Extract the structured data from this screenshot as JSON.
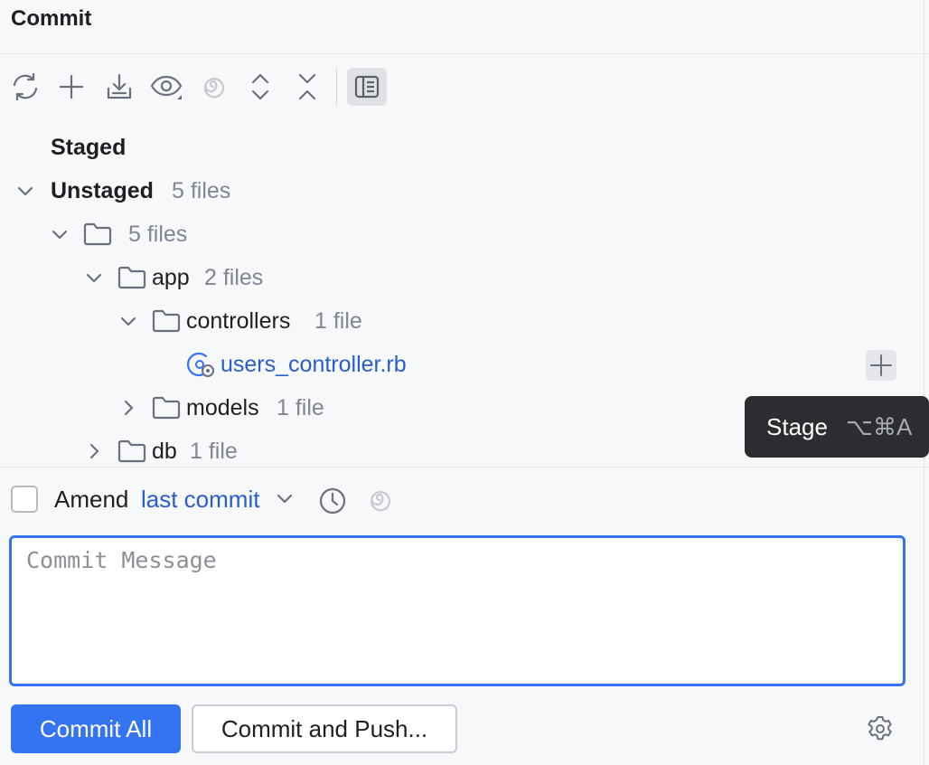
{
  "panel": {
    "title": "Commit"
  },
  "toolbar": {
    "buttons": [
      {
        "icon": "refresh-icon",
        "tooltip": "Refresh"
      },
      {
        "icon": "plus-icon",
        "tooltip": "Add"
      },
      {
        "icon": "download-icon",
        "tooltip": "Update"
      },
      {
        "icon": "eye-icon",
        "tooltip": "View Options"
      },
      {
        "icon": "ai-swirl-icon",
        "tooltip": "AI"
      },
      {
        "icon": "expand-all-icon",
        "tooltip": "Expand All"
      },
      {
        "icon": "collapse-all-icon",
        "tooltip": "Collapse All"
      },
      {
        "icon": "preview-panel-icon",
        "tooltip": "Show Diff Preview"
      }
    ]
  },
  "tree": {
    "staged": {
      "label": "Staged"
    },
    "unstaged": {
      "label": "Unstaged",
      "count": "5 files"
    },
    "root": {
      "label": "",
      "count": "5 files"
    },
    "app": {
      "label": "app",
      "count": "2 files"
    },
    "controllers": {
      "label": "controllers",
      "count": "1 file"
    },
    "users_controller": {
      "label": "users_controller.rb"
    },
    "models": {
      "label": "models",
      "count": "1 file"
    },
    "db": {
      "label": "db",
      "count": "1 file"
    }
  },
  "tooltip": {
    "label": "Stage",
    "shortcut": "⌥⌘A"
  },
  "amend": {
    "label": "Amend",
    "link": "last commit",
    "checked": false
  },
  "message": {
    "placeholder": "Commit Message",
    "value": ""
  },
  "actions": {
    "commit_all": "Commit All",
    "commit_and_push": "Commit and Push..."
  },
  "colors": {
    "accent": "#3574f0",
    "link": "#2a5dc9",
    "muted": "#818594",
    "background": "#f7f8fa"
  }
}
